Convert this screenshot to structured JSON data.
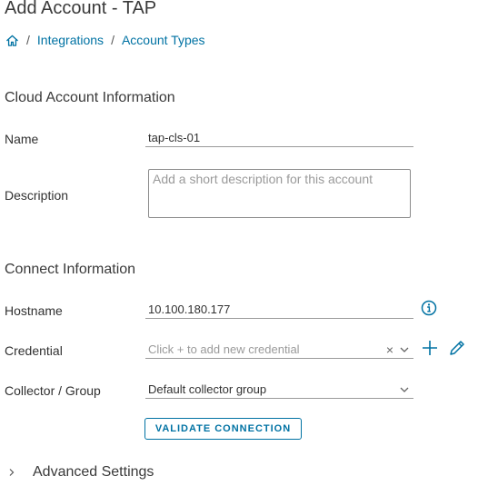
{
  "page": {
    "title": "Add Account - TAP"
  },
  "breadcrumb": {
    "home_icon": "home-icon",
    "separator": "/",
    "items": [
      {
        "label": "Integrations"
      },
      {
        "label": "Account Types"
      }
    ]
  },
  "cloud_section": {
    "title": "Cloud Account Information",
    "name_label": "Name",
    "name_value": "tap-cls-01",
    "description_label": "Description",
    "description_placeholder": "Add a short description for this account",
    "description_value": ""
  },
  "connect_section": {
    "title": "Connect Information",
    "hostname_label": "Hostname",
    "hostname_value": "10.100.180.177",
    "hostname_info_icon": "info-icon",
    "credential_label": "Credential",
    "credential_placeholder": "Click + to add new credential",
    "credential_clear": "×",
    "credential_add_icon": "plus-icon",
    "credential_edit_icon": "pencil-icon",
    "collector_label": "Collector / Group",
    "collector_value": "Default collector group",
    "validate_label": "VALIDATE CONNECTION"
  },
  "advanced": {
    "label": "Advanced Settings",
    "icon": "chevron-right-icon"
  },
  "colors": {
    "accent": "#0072a3",
    "text": "#313131",
    "placeholder": "#9a9a9a"
  }
}
